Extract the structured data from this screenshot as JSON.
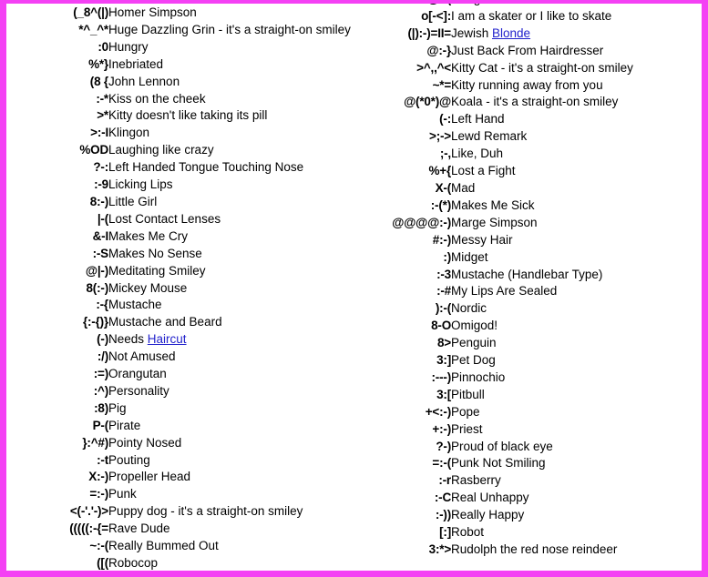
{
  "page": {
    "border_color": "#f441f4",
    "background_color": "#ffffff",
    "link_color": "#2222cc",
    "text_color": "#000000"
  },
  "columns": {
    "left": {
      "rows": [
        {
          "emoticon": "(_8^(|)",
          "description": "Homer Simpson"
        },
        {
          "emoticon": "*^_^*",
          "description": "Huge Dazzling Grin - it's a straight-on smiley"
        },
        {
          "emoticon": ":0",
          "description": "Hungry"
        },
        {
          "emoticon": "%*}",
          "description": "Inebriated"
        },
        {
          "emoticon": "(8 {",
          "description": "John Lennon"
        },
        {
          "emoticon": ":-*",
          "description": "Kiss on the cheek"
        },
        {
          "emoticon": ">*",
          "description": "Kitty doesn't like taking its pill"
        },
        {
          "emoticon": ">:-I",
          "description": "Klingon"
        },
        {
          "emoticon": "%OD",
          "description": "Laughing like crazy"
        },
        {
          "emoticon": "?-:",
          "description": "Left Handed Tongue Touching Nose"
        },
        {
          "emoticon": ":-9",
          "description": "Licking Lips"
        },
        {
          "emoticon": "8:-)",
          "description": "Little Girl"
        },
        {
          "emoticon": "|-(",
          "description": "Lost Contact Lenses"
        },
        {
          "emoticon": "&-I",
          "description": "Makes Me Cry"
        },
        {
          "emoticon": ":-S",
          "description": "Makes No Sense"
        },
        {
          "emoticon": "@|-)",
          "description": "Meditating Smiley"
        },
        {
          "emoticon": "8(:-)",
          "description": "Mickey Mouse"
        },
        {
          "emoticon": ":-{",
          "description": "Mustache"
        },
        {
          "emoticon": "{:-{)}",
          "description": "Mustache and Beard"
        },
        {
          "emoticon": "(-)",
          "description_prefix": "Needs ",
          "link_text": "Haircut"
        },
        {
          "emoticon": ":/)",
          "description": "Not Amused"
        },
        {
          "emoticon": ":=)",
          "description": "Orangutan"
        },
        {
          "emoticon": ":^)",
          "description": "Personality"
        },
        {
          "emoticon": ":8)",
          "description": "Pig"
        },
        {
          "emoticon": "P-(",
          "description": "Pirate"
        },
        {
          "emoticon": "}:^#)",
          "description": "Pointy Nosed"
        },
        {
          "emoticon": ":-t",
          "description": "Pouting"
        },
        {
          "emoticon": "X:-)",
          "description": "Propeller Head"
        },
        {
          "emoticon": "=:-)",
          "description": "Punk"
        },
        {
          "emoticon": "<(-'.'-)>",
          "description": "Puppy dog - it's a straight-on smiley"
        },
        {
          "emoticon": "(((((:-{=",
          "description": "Rave Dude"
        },
        {
          "emoticon": "~:-(",
          "description": "Really Bummed Out"
        },
        {
          "emoticon": "([(",
          "description": "Robocop"
        }
      ]
    },
    "right": {
      "rows": [
        {
          "emoticon": "",
          "description": "",
          "clipped": true
        },
        {
          "emoticon": "%*@:-(",
          "description": "Hungover with headache"
        },
        {
          "emoticon": "o[-<]:",
          "description": "I am a skater or I like to skate"
        },
        {
          "emoticon": "(|):-)=II=",
          "description_prefix": "Jewish ",
          "link_text": "Blonde"
        },
        {
          "emoticon": "@:-}",
          "description": "Just Back From Hairdresser"
        },
        {
          "emoticon": ">^,,^<",
          "description": "Kitty Cat - it's a straight-on smiley"
        },
        {
          "emoticon": "~*=",
          "description": "Kitty running away from you"
        },
        {
          "emoticon": "@(*0*)@",
          "description": "Koala - it's a straight-on smiley"
        },
        {
          "emoticon": "(-:",
          "description": "Left Hand"
        },
        {
          "emoticon": ">;->",
          "description": "Lewd Remark"
        },
        {
          "emoticon": ";-,",
          "description": "Like, Duh"
        },
        {
          "emoticon": "%+{",
          "description": "Lost a Fight"
        },
        {
          "emoticon": "X-(",
          "description": "Mad"
        },
        {
          "emoticon": ":-(*)",
          "description": "Makes Me Sick"
        },
        {
          "emoticon": "@@@@:-)",
          "description": "Marge Simpson"
        },
        {
          "emoticon": "#:-)",
          "description": "Messy Hair"
        },
        {
          "emoticon": ":)",
          "description": "Midget"
        },
        {
          "emoticon": ":-3",
          "description": "Mustache (Handlebar Type)"
        },
        {
          "emoticon": ":-#",
          "description": "My Lips Are Sealed"
        },
        {
          "emoticon": "):-(",
          "description": "Nordic"
        },
        {
          "emoticon": "8-O",
          "description": "Omigod!"
        },
        {
          "emoticon": "8>",
          "description": "Penguin"
        },
        {
          "emoticon": "3:]",
          "description": "Pet Dog"
        },
        {
          "emoticon": ":---)",
          "description": "Pinnochio"
        },
        {
          "emoticon": "3:[",
          "description": "Pitbull"
        },
        {
          "emoticon": "+<:-)",
          "description": "Pope"
        },
        {
          "emoticon": "+:-)",
          "description": "Priest"
        },
        {
          "emoticon": "?-)",
          "description": "Proud of black eye"
        },
        {
          "emoticon": "=:-(",
          "description": "Punk Not Smiling"
        },
        {
          "emoticon": ":-r",
          "description": "Rasberry"
        },
        {
          "emoticon": ":-C",
          "description": "Real Unhappy"
        },
        {
          "emoticon": ":-))",
          "description": "Really Happy"
        },
        {
          "emoticon": "[:]",
          "description": "Robot"
        },
        {
          "emoticon": "3:*>",
          "description": "Rudolph the red nose reindeer"
        }
      ]
    }
  }
}
